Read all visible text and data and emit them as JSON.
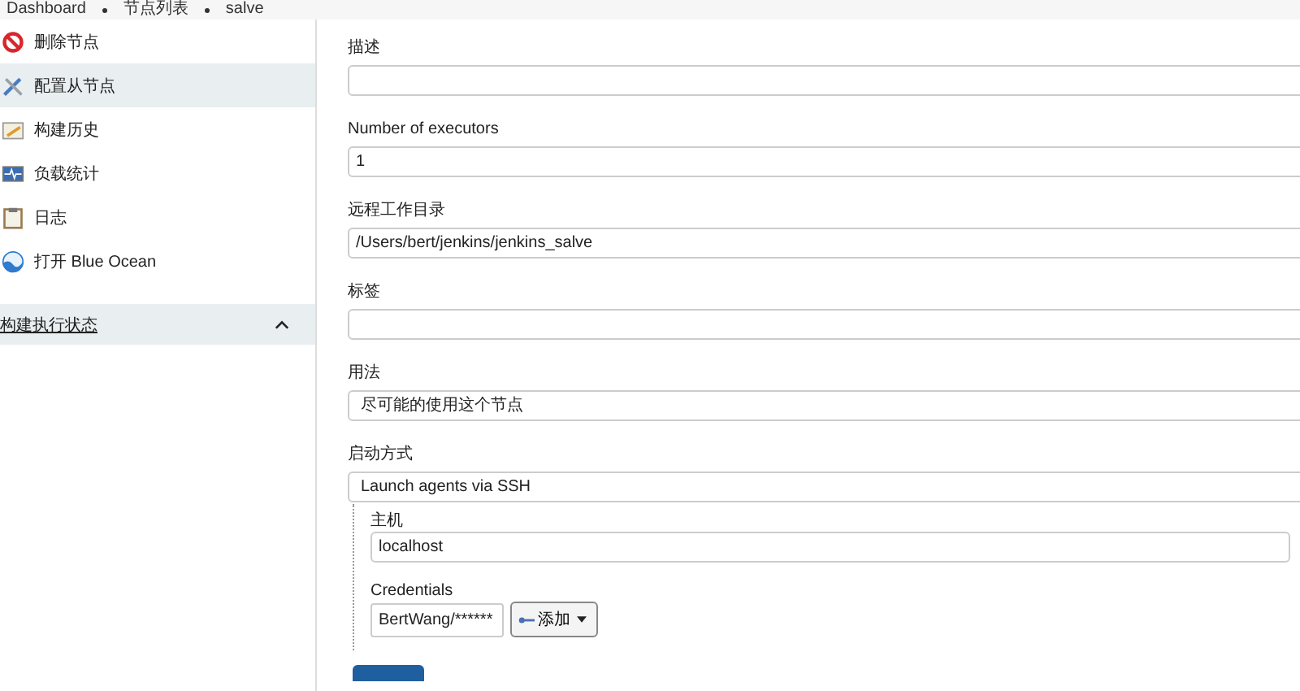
{
  "breadcrumb": [
    "Dashboard",
    "节点列表",
    "salve"
  ],
  "sidebar": {
    "items": [
      {
        "label": "删除节点",
        "selected": false
      },
      {
        "label": "配置从节点",
        "selected": true
      },
      {
        "label": "构建历史",
        "selected": false
      },
      {
        "label": "负载统计",
        "selected": false
      },
      {
        "label": "日志",
        "selected": false
      },
      {
        "label": "打开 Blue Ocean",
        "selected": false
      }
    ],
    "section": {
      "title": "构建执行状态",
      "expanded": true
    }
  },
  "form": {
    "fields": [
      {
        "label": "描述",
        "kind": "text"
      },
      {
        "label": "Number of executors",
        "kind": "text",
        "value": "1"
      },
      {
        "label": "远程工作目录",
        "kind": "text",
        "value": "/Users/bert/jenkins/jenkins_salve"
      },
      {
        "label": "标签",
        "kind": "text"
      },
      {
        "label": "用法",
        "kind": "select",
        "value": "尽可能的使用这个节点"
      },
      {
        "label": "启动方式",
        "kind": "select",
        "value": "Launch agents via SSH"
      }
    ],
    "launch": {
      "host_label": "主机",
      "host": "localhost",
      "credentials_label": "Credentials",
      "credential": "BertWang/******",
      "add_button": "添加"
    }
  }
}
